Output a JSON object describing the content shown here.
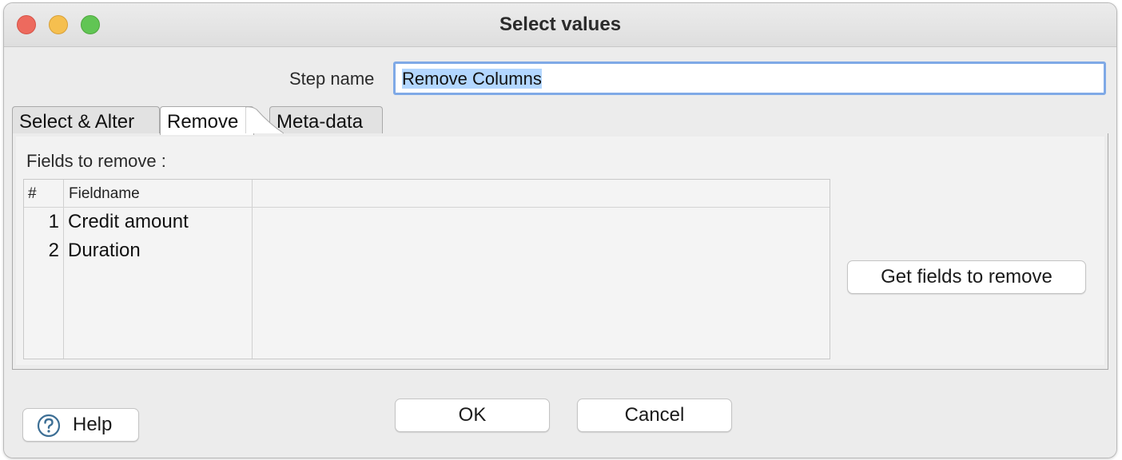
{
  "window": {
    "title": "Select values"
  },
  "step_name": {
    "label": "Step name",
    "value": "Remove Columns"
  },
  "tabs": [
    {
      "label": "Select & Alter",
      "active": false
    },
    {
      "label": "Remove",
      "active": true
    },
    {
      "label": "Meta-data",
      "active": false
    }
  ],
  "remove_tab": {
    "fields_label": "Fields to remove :",
    "table": {
      "columns": [
        "#",
        "Fieldname"
      ],
      "rows": [
        {
          "num": "1",
          "fieldname": "Credit amount"
        },
        {
          "num": "2",
          "fieldname": "Duration"
        }
      ]
    },
    "get_fields_button": "Get fields to remove"
  },
  "buttons": {
    "ok": "OK",
    "cancel": "Cancel",
    "help": "Help"
  },
  "icons": {
    "help": "question-circle-icon"
  },
  "colors": {
    "close": "#ed6a5e",
    "minimize": "#f5bf4f",
    "maximize": "#61c554",
    "focus_ring": "#7fa9e6",
    "selection": "#b3d7ff"
  }
}
